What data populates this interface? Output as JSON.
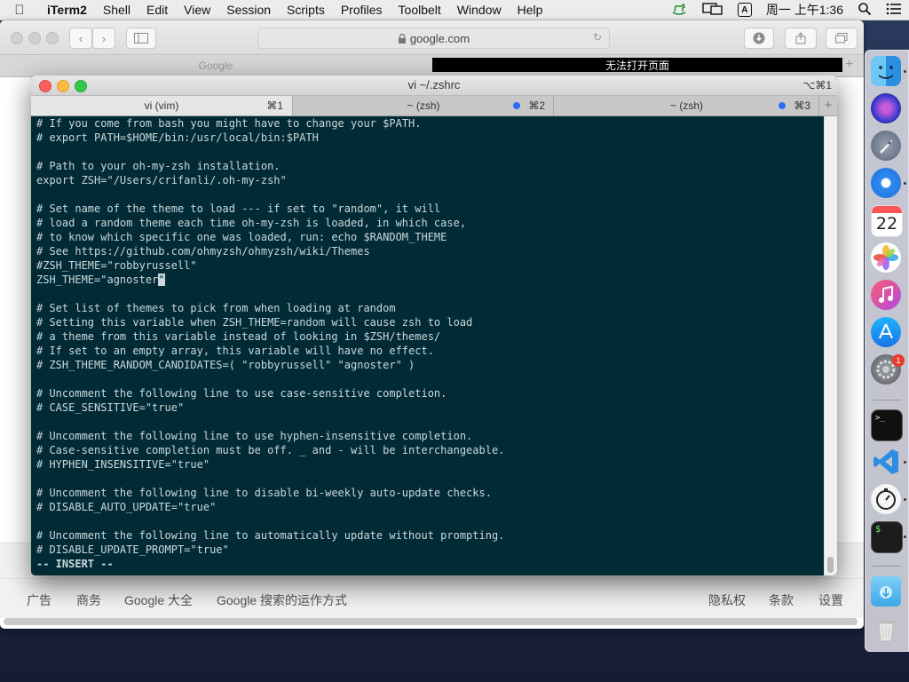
{
  "menubar": {
    "app_name": "iTerm2",
    "items": [
      "Shell",
      "Edit",
      "View",
      "Session",
      "Scripts",
      "Profiles",
      "Toolbelt",
      "Window",
      "Help"
    ],
    "input_method": "A",
    "clock": "周一 上午1:36"
  },
  "safari": {
    "url": "google.com",
    "tab_left": "Google",
    "tab_right": "无法打开页面",
    "footer_left": [
      "广告",
      "商务",
      "Google 大全",
      "Google 搜索的运作方式"
    ],
    "footer_right": [
      "隐私权",
      "条款",
      "设置"
    ]
  },
  "iterm": {
    "title": "vi ~/.zshrc",
    "title_shortcut": "⌥⌘1",
    "tabs": [
      {
        "label": "vi (vim)",
        "key": "⌘1"
      },
      {
        "label": "~ (zsh)",
        "key": "⌘2"
      },
      {
        "label": "~ (zsh)",
        "key": "⌘3"
      }
    ],
    "plus": "+",
    "lines": [
      "# If you come from bash you might have to change your $PATH.",
      "# export PATH=$HOME/bin:/usr/local/bin:$PATH",
      "",
      "# Path to your oh-my-zsh installation.",
      "export ZSH=\"/Users/crifanli/.oh-my-zsh\"",
      "",
      "# Set name of the theme to load --- if set to \"random\", it will",
      "# load a random theme each time oh-my-zsh is loaded, in which case,",
      "# to know which specific one was loaded, run: echo $RANDOM_THEME",
      "# See https://github.com/ohmyzsh/ohmyzsh/wiki/Themes",
      "#ZSH_THEME=\"robbyrussell\"",
      "",
      "",
      "# Set list of themes to pick from when loading at random",
      "# Setting this variable when ZSH_THEME=random will cause zsh to load",
      "# a theme from this variable instead of looking in $ZSH/themes/",
      "# If set to an empty array, this variable will have no effect.",
      "# ZSH_THEME_RANDOM_CANDIDATES=( \"robbyrussell\" \"agnoster\" )",
      "",
      "# Uncomment the following line to use case-sensitive completion.",
      "# CASE_SENSITIVE=\"true\"",
      "",
      "# Uncomment the following line to use hyphen-insensitive completion.",
      "# Case-sensitive completion must be off. _ and - will be interchangeable.",
      "# HYPHEN_INSENSITIVE=\"true\"",
      "",
      "# Uncomment the following line to disable bi-weekly auto-update checks.",
      "# DISABLE_AUTO_UPDATE=\"true\"",
      "",
      "# Uncomment the following line to automatically update without prompting.",
      "# DISABLE_UPDATE_PROMPT=\"true\""
    ],
    "cursor_line_prefix": "ZSH_THEME=\"agnoster",
    "cursor_char": "\"",
    "mode_line": "-- INSERT --"
  },
  "dock": {
    "calendar_day": "22",
    "badge_count": "1",
    "terminal_glyph": ">_",
    "shell_glyph": "$"
  }
}
